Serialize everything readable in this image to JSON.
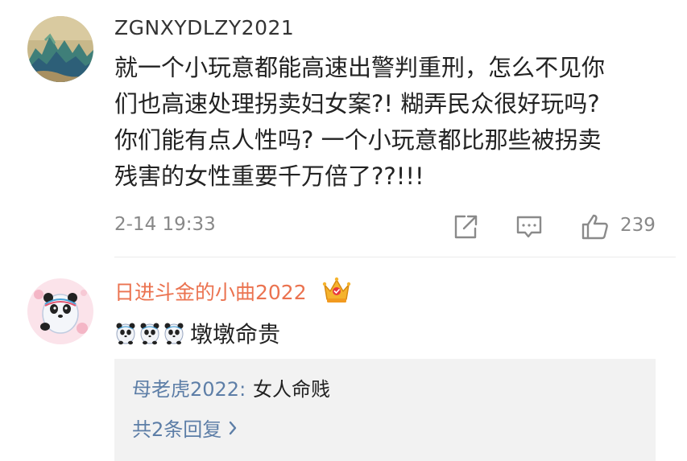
{
  "comments": [
    {
      "username": "ZGNXYDLZY2021",
      "text_lines": [
        "就一个小玩意都能高速出警判重刑，怎么不见你",
        "们也高速处理拐卖妇女案?! 糊弄民众很好玩吗?",
        "你们能有点人性吗? 一个小玩意都比那些被拐卖",
        "残害的女性重要千万倍了??!!!"
      ],
      "timestamp": "2-14 19:33",
      "like_count": "239",
      "icons": [
        "share-icon",
        "reply-icon",
        "like-icon"
      ]
    },
    {
      "username": "日进斗金的小曲2022",
      "badge_icon": "crown-icon",
      "emojis": [
        "panda-emoji",
        "panda-emoji",
        "panda-emoji"
      ],
      "text": "墩墩命贵",
      "reply_preview": {
        "user": "母老虎2022:",
        "text": "女人命贱",
        "more_label": "共2条回复",
        "more_icon": "chevron-right-icon"
      }
    }
  ],
  "colors": {
    "username_highlight": "#eb7350",
    "link_blue": "#5d7ea7",
    "meta_gray": "#888888",
    "reply_bg": "#f2f2f2"
  }
}
